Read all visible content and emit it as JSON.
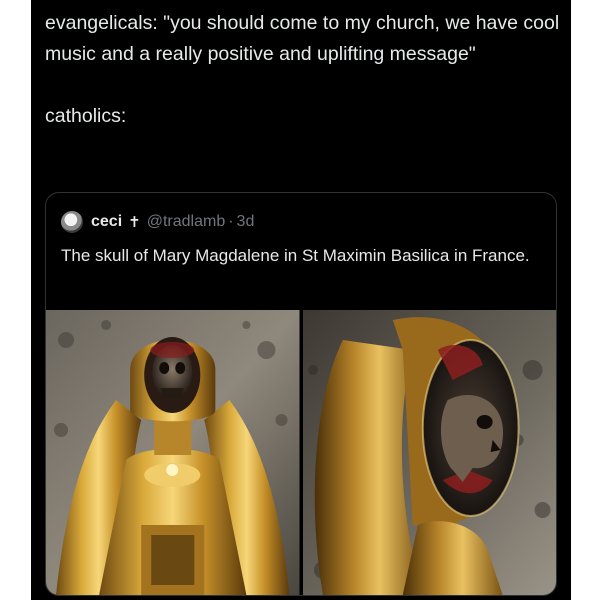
{
  "post": {
    "text": "evangelicals: \"you should come to my church, we have cool music and a really positive and uplifting message\"\n\ncatholics:"
  },
  "quote": {
    "author_name": "ceci",
    "badge_icon": "cross-icon",
    "badge_glyph": "✝",
    "handle": "@tradlamb",
    "separator": "·",
    "time": "3d",
    "text": "The skull of Mary Magdalene in St Maximin Basilica in France."
  },
  "media": {
    "images": [
      {
        "name": "reliquary-front-photo",
        "icon": "reliquary-front-image"
      },
      {
        "name": "reliquary-side-photo",
        "icon": "reliquary-side-image"
      }
    ]
  }
}
